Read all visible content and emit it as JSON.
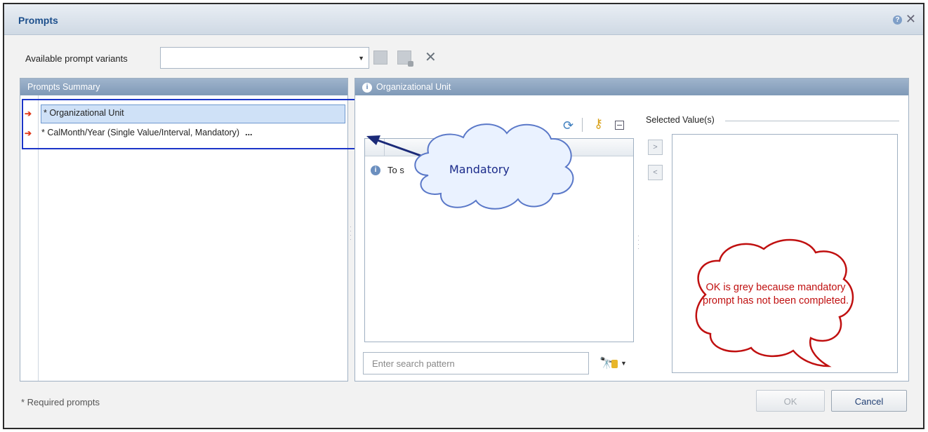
{
  "dialog": {
    "title": "Prompts",
    "help_glyph": "?",
    "close_glyph": "✕"
  },
  "variants": {
    "label": "Available prompt variants",
    "value": "",
    "dropdown_glyph": "▼",
    "delete_glyph": "✕"
  },
  "summary": {
    "header": "Prompts Summary",
    "items": [
      {
        "label": "* Organizational Unit",
        "selected": true
      },
      {
        "label": "* CalMonth/Year (Single Value/Interval, Mandatory)",
        "ellipsis": "..."
      }
    ]
  },
  "org_panel": {
    "header": "Organizational Unit",
    "info_glyph": "i",
    "info_message": "To s                                     Refresh Values.",
    "add_glyph": ">",
    "remove_glyph": "<",
    "selected_title": "Selected Value(s)",
    "search": {
      "placeholder": "Enter search pattern"
    },
    "search_dd_glyph": "▼"
  },
  "footer": {
    "required_note": "* Required prompts",
    "ok_label": "OK",
    "cancel_label": "Cancel"
  },
  "annotations": {
    "cloud_text": "Mandatory",
    "bubble_text": "OK is grey because mandatory prompt has not been completed."
  },
  "colors": {
    "accent": "#1d4f8c",
    "highlight_box": "#1b35c8",
    "arrow_marker": "#e13a1a",
    "bubble_border": "#c01010",
    "cloud_fill": "#eaf2ff"
  }
}
